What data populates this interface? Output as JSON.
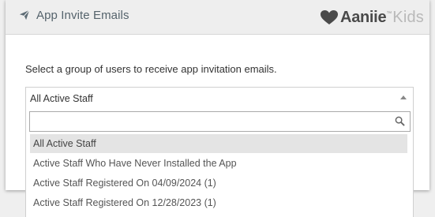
{
  "modal": {
    "title": "App Invite Emails",
    "logo": {
      "brand": "Aaniie",
      "tm": "™",
      "sub": "Kids"
    }
  },
  "prompt": "Select a group of users to receive app invitation emails.",
  "select": {
    "value": "All Active Staff",
    "search_placeholder": ""
  },
  "options": [
    {
      "label": "All Active Staff",
      "highlighted": true
    },
    {
      "label": "Active Staff Who Have Never Installed the App",
      "highlighted": false
    },
    {
      "label": "Active Staff Registered On 04/09/2024 (1)",
      "highlighted": false
    },
    {
      "label": "Active Staff Registered On 12/28/2023 (1)",
      "highlighted": false
    }
  ],
  "colors": {
    "header_bg": "#eeeeee",
    "title_text": "#55636c",
    "highlight_bg": "#e4e4e4"
  },
  "icons": {
    "header": "paper-plane-icon",
    "search": "search-icon",
    "select_arrow": "caret-up-icon",
    "logo": "heart-icon"
  }
}
